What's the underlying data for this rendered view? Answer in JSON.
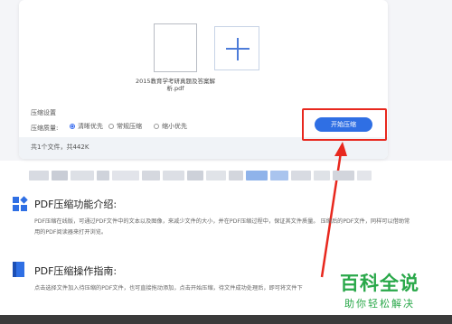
{
  "upload_card": {
    "file_name": "2015教育学考研真题及答案解析.pdf",
    "settings_label": "压缩设置",
    "quality_label": "压缩质量:",
    "options": [
      {
        "label": "清晰优先",
        "selected": true
      },
      {
        "label": "常规压缩",
        "selected": false
      },
      {
        "label": "缩小优先",
        "selected": false
      }
    ],
    "start_button": "开始压缩",
    "file_count": "共1个文件，共442K"
  },
  "intro": {
    "title": "PDF压缩功能介绍:",
    "text": "PDF压缩在线版，可通过PDF文件中的文本以及图像，来减少文件的大小，并在PDF压缩过程中，保证其文件质量。 压缩后的PDF文件，同样可以借助常用的PDF阅读器来打开浏览。"
  },
  "guide": {
    "title": "PDF压缩操作指南:",
    "text": "点击选择文件加入待压缩的PDF文件，也可直接拖动添加，点击开始压缩，待文件成功处理后，即可将文件下"
  },
  "watermark": {
    "line1": "百科全说",
    "line2": "助你轻松解决"
  },
  "colors": {
    "accent": "#2f6fe4",
    "highlight": "#e8281e",
    "watermark": "#2aa84a"
  }
}
